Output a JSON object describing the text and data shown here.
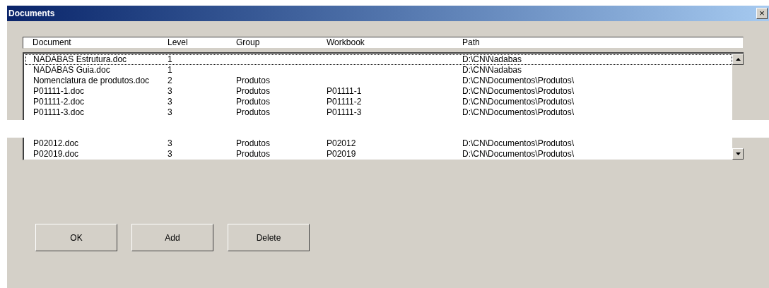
{
  "window": {
    "title": "Documents",
    "close": "×"
  },
  "table": {
    "columns": [
      "Document",
      "Level",
      "Group",
      "Workbook",
      "Path"
    ],
    "rows": [
      {
        "cells": [
          "NADABAS Estrutura.doc",
          "1",
          "",
          "",
          "D:\\CN\\Nadabas"
        ],
        "focused": true
      },
      {
        "cells": [
          "NADABAS Guia.doc",
          "1",
          "",
          "",
          "D:\\CN\\Nadabas"
        ],
        "focused": false
      },
      {
        "cells": [
          "Nomenclatura de produtos.doc",
          "2",
          "Produtos",
          "",
          "D:\\CN\\Documentos\\Produtos\\"
        ],
        "focused": false
      },
      {
        "cells": [
          "P01111-1.doc",
          "3",
          "Produtos",
          "P01111-1",
          "D:\\CN\\Documentos\\Produtos\\"
        ],
        "focused": false
      },
      {
        "cells": [
          "P01111-2.doc",
          "3",
          "Produtos",
          "P01111-2",
          "D:\\CN\\Documentos\\Produtos\\"
        ],
        "focused": false
      },
      {
        "cells": [
          "P01111-3.doc",
          "3",
          "Produtos",
          "P01111-3",
          "D:\\CN\\Documentos\\Produtos\\"
        ],
        "focused": false
      },
      {
        "cells": [
          "P02012.doc",
          "3",
          "Produtos",
          "P02012",
          "D:\\CN\\Documentos\\Produtos\\"
        ],
        "focused": false
      },
      {
        "cells": [
          "P02019.doc",
          "3",
          "Produtos",
          "P02019",
          "D:\\CN\\Documentos\\Produtos\\"
        ],
        "focused": false
      }
    ]
  },
  "buttons": [
    "OK",
    "Add",
    "Delete"
  ]
}
